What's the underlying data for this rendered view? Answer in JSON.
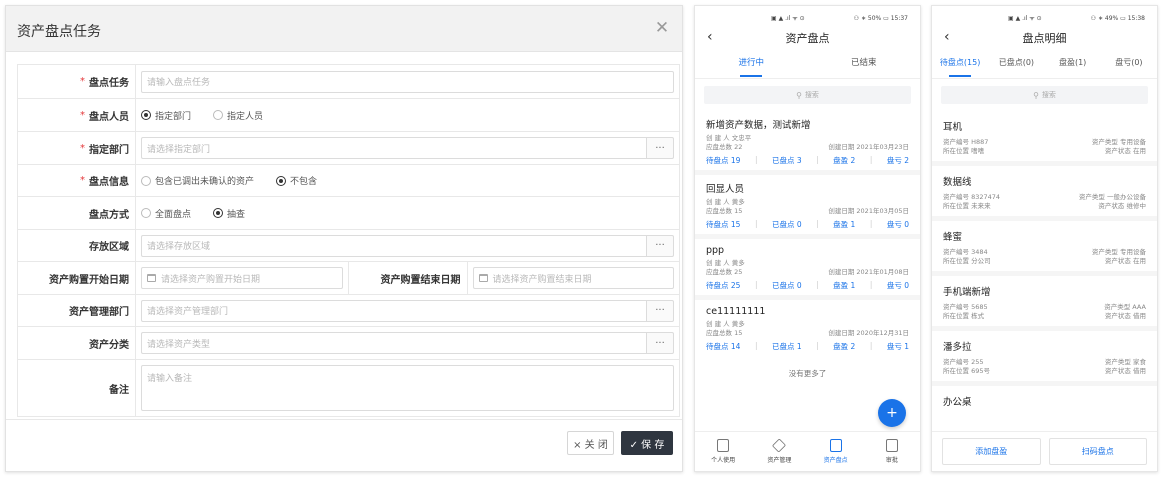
{
  "dialog": {
    "title": "资产盘点任务",
    "fields": {
      "task": {
        "label": "盘点任务",
        "placeholder": "请输入盘点任务"
      },
      "staff": {
        "label": "盘点人员",
        "opt1": "指定部门",
        "opt2": "指定人员"
      },
      "dept": {
        "label": "指定部门",
        "placeholder": "请选择指定部门"
      },
      "info": {
        "label": "盘点信息",
        "opt1": "包含已调出未确认的资产",
        "opt2": "不包含"
      },
      "mode": {
        "label": "盘点方式",
        "opt1": "全面盘点",
        "opt2": "抽查"
      },
      "area": {
        "label": "存放区域",
        "placeholder": "请选择存放区域"
      },
      "start": {
        "label": "资产购置开始日期",
        "placeholder": "请选择资产购置开始日期"
      },
      "end": {
        "label": "资产购置结束日期",
        "placeholder": "请选择资产购置结束日期"
      },
      "mgr": {
        "label": "资产管理部门",
        "placeholder": "请选择资产管理部门"
      },
      "cat": {
        "label": "资产分类",
        "placeholder": "请选择资产类型"
      },
      "note": {
        "label": "备注",
        "placeholder": "请输入备注"
      }
    },
    "dots": "···",
    "close_label": "× 关 闭",
    "save_label": "✓ 保 存"
  },
  "phone1": {
    "status_left": "▣ ▲ .ıl ᯤ ⊙",
    "status_right": "⚇ ∗ 50% ▭ 15:37",
    "title": "资产盘点",
    "tabs": [
      "进行中",
      "已结束"
    ],
    "search": "搜索",
    "tasks": [
      {
        "name": "新增资产数据，测试新增",
        "creator": "创 建 人  文忠平",
        "total": "应盘总数  22",
        "date": "创建日期  2021年03月23日",
        "pending": "待盘点 19",
        "done": "已盘点 3",
        "surplus": "盘盈 2",
        "loss": "盘亏 2"
      },
      {
        "name": "回显人员",
        "creator": "创 建 人  黄多",
        "total": "应盘总数  15",
        "date": "创建日期  2021年03月05日",
        "pending": "待盘点 15",
        "done": "已盘点 0",
        "surplus": "盘盈 1",
        "loss": "盘亏 0"
      },
      {
        "name": "ppp",
        "creator": "创 建 人  黄多",
        "total": "应盘总数  25",
        "date": "创建日期  2021年01月08日",
        "pending": "待盘点 25",
        "done": "已盘点 0",
        "surplus": "盘盈 1",
        "loss": "盘亏 0"
      },
      {
        "name": "ce11111111",
        "creator": "创 建 人  黄多",
        "total": "应盘总数  15",
        "date": "创建日期  2020年12月31日",
        "pending": "待盘点 14",
        "done": "已盘点 1",
        "surplus": "盘盈 2",
        "loss": "盘亏 1"
      }
    ],
    "no_more": "没有更多了",
    "fab": "+",
    "bottom": [
      "个人使用",
      "资产管理",
      "资产盘点",
      "审批"
    ]
  },
  "phone2": {
    "status_left": "▣ ▲ .ıl ᯤ ⊙",
    "status_right": "⚇ ∗ 49% ▭ 15:38",
    "title": "盘点明细",
    "tabs": [
      "待盘点(15)",
      "已盘点(0)",
      "盘盈(1)",
      "盘亏(0)"
    ],
    "search": "搜索",
    "assets": [
      {
        "name": "耳机",
        "code": "资产编号  H887",
        "type": "资产类型  专用设备",
        "loc": "所在位置  嗜嗜",
        "state": "资产状态  在用"
      },
      {
        "name": "数据线",
        "code": "资产编号  8327474",
        "type": "资产类型  一般办公设备",
        "loc": "所在位置  未来来",
        "state": "资产状态  维修中"
      },
      {
        "name": "蜂蜜",
        "code": "资产编号  3484",
        "type": "资产类型  专用设备",
        "loc": "所在位置  分公司",
        "state": "资产状态  在用"
      },
      {
        "name": "手机端新增",
        "code": "资产编号  5685",
        "type": "资产类型  AAA",
        "loc": "所在位置  栋式",
        "state": "资产状态  借用"
      },
      {
        "name": "潘多拉",
        "code": "资产编号  255",
        "type": "资产类型  家食",
        "loc": "所在位置  695号",
        "state": "资产状态  借用"
      },
      {
        "name": "办公桌",
        "code": "",
        "type": "",
        "loc": "",
        "state": ""
      }
    ],
    "btn_add": "添加盘盈",
    "btn_scan": "扫码盘点"
  }
}
